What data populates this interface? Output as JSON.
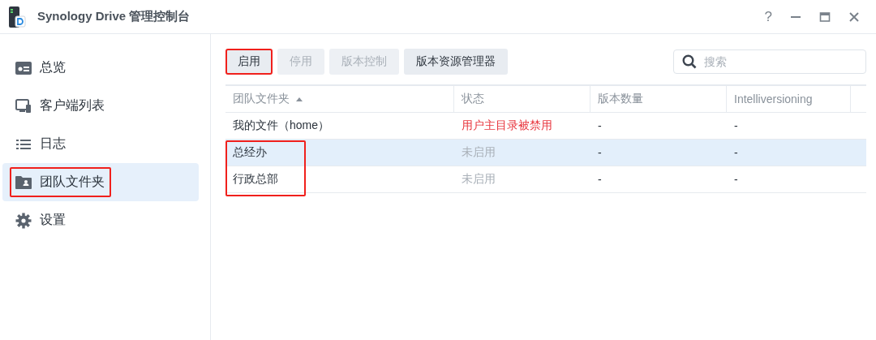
{
  "window": {
    "title": "Synology Drive 管理控制台",
    "controls": [
      "?"
    ]
  },
  "sidebar": {
    "items": [
      {
        "label": "总览",
        "kind": "overview",
        "selected": false,
        "marked": false
      },
      {
        "label": "客户端列表",
        "kind": "clients",
        "selected": false,
        "marked": false
      },
      {
        "label": "日志",
        "kind": "log",
        "selected": false,
        "marked": false
      },
      {
        "label": "团队文件夹",
        "kind": "folder",
        "selected": true,
        "marked": true
      },
      {
        "label": "设置",
        "kind": "settings",
        "selected": false,
        "marked": false
      }
    ]
  },
  "toolbar": {
    "buttons": [
      {
        "label": "启用",
        "disabled": false,
        "marked": true
      },
      {
        "label": "停用",
        "disabled": true,
        "marked": false
      },
      {
        "label": "版本控制",
        "disabled": true,
        "marked": false
      },
      {
        "label": "版本资源管理器",
        "disabled": false,
        "marked": false
      }
    ]
  },
  "search": {
    "placeholder": "搜索"
  },
  "table": {
    "columns": [
      {
        "label": "团队文件夹",
        "sorted": true
      },
      {
        "label": "状态",
        "sorted": false
      },
      {
        "label": "版本数量",
        "sorted": false
      },
      {
        "label": "Intelliversioning",
        "sorted": false
      }
    ],
    "rows": [
      {
        "name": "我的文件（home）",
        "status": "用户主目录被禁用",
        "kind": "error",
        "versions": "-",
        "intelliversioning": "-",
        "selected": false,
        "marked": false
      },
      {
        "name": "总经办",
        "status": "未启用",
        "kind": "inactive",
        "versions": "-",
        "intelliversioning": "-",
        "selected": true,
        "marked": true
      },
      {
        "name": "行政总部",
        "status": "未启用",
        "kind": "inactive",
        "versions": "-",
        "intelliversioning": "-",
        "selected": false,
        "marked": true
      }
    ]
  }
}
